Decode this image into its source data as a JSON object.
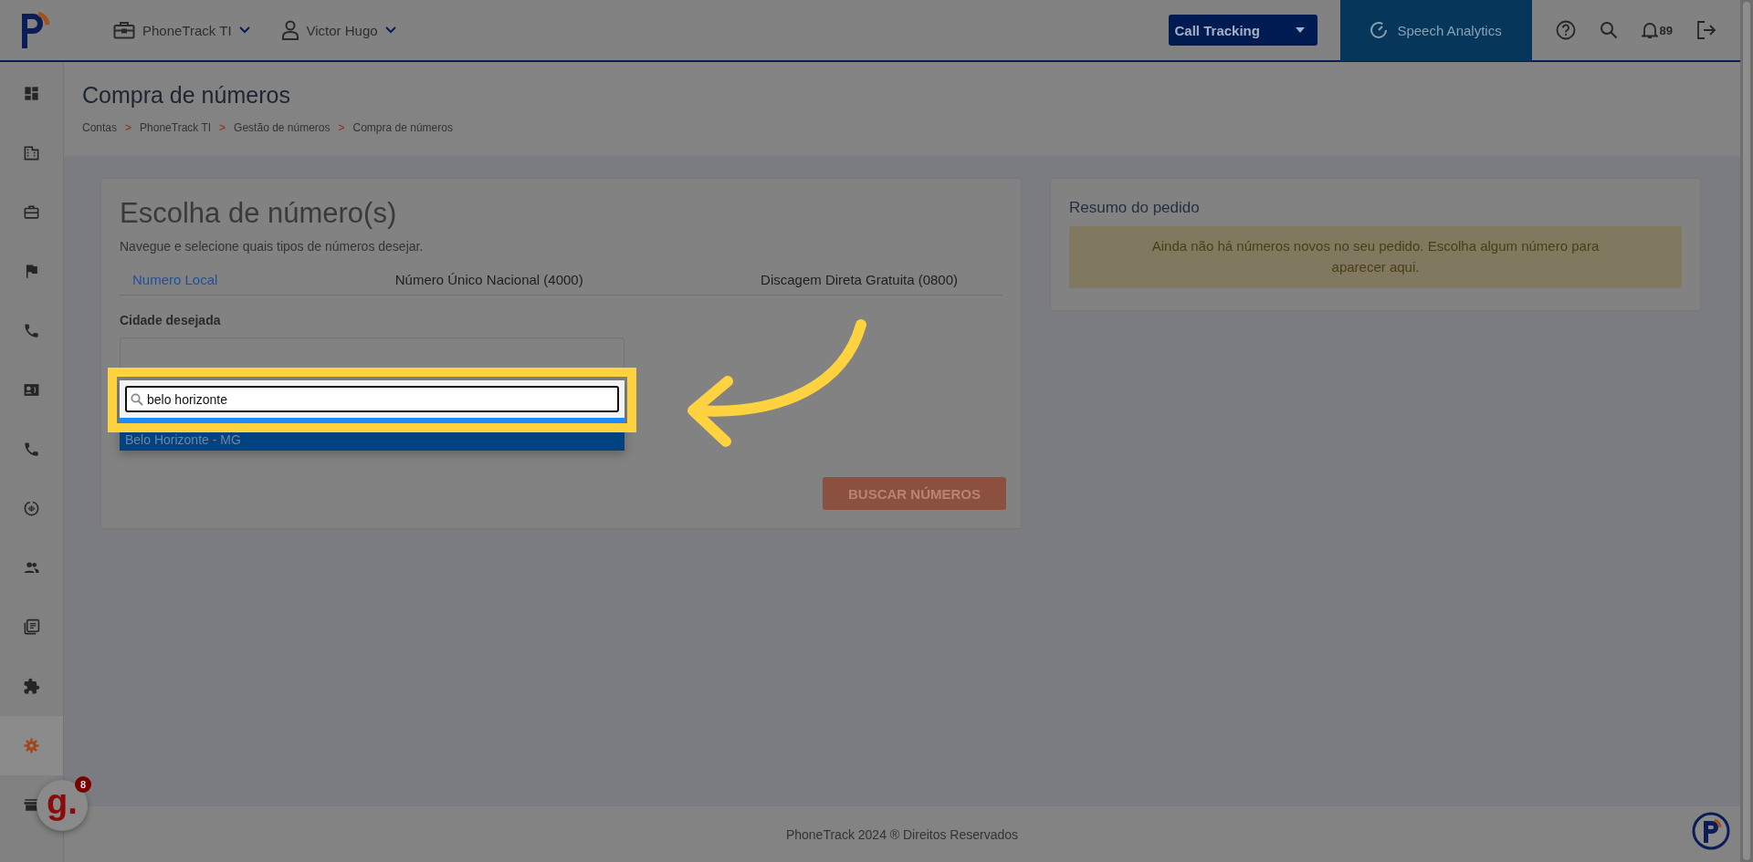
{
  "topbar": {
    "account": "PhoneTrack TI",
    "user": "Victor Hugo",
    "product_select": "Call Tracking",
    "speech_analytics": "Speech Analytics",
    "notifications": "89"
  },
  "sidebar": {
    "items": [
      {
        "kind": "dashboard",
        "selected": false
      },
      {
        "kind": "building",
        "selected": false
      },
      {
        "kind": "briefcase",
        "selected": false
      },
      {
        "kind": "flag",
        "selected": false
      },
      {
        "kind": "phone",
        "selected": false
      },
      {
        "kind": "contact",
        "selected": false
      },
      {
        "kind": "phone",
        "selected": false
      },
      {
        "kind": "audio",
        "selected": false
      },
      {
        "kind": "people",
        "selected": false
      },
      {
        "kind": "library",
        "selected": false
      },
      {
        "kind": "puzzle",
        "selected": false
      },
      {
        "kind": "gear",
        "selected": true
      },
      {
        "kind": "store",
        "selected": false
      }
    ]
  },
  "page": {
    "title": "Compra de números",
    "breadcrumb": {
      "separator": ">",
      "items": [
        "Contas",
        "PhoneTrack TI",
        "Gestão de números",
        "Compra de números"
      ]
    }
  },
  "choice_card": {
    "title": "Escolha de número(s)",
    "subtitle": "Navegue e selecione quais tipos de números desejar.",
    "tabs": [
      {
        "label": "Numero Local",
        "selected": true
      },
      {
        "label": "Número Único Nacional (4000)",
        "selected": false
      },
      {
        "label": "Discagem Direta Gratuita (0800)",
        "selected": false
      }
    ],
    "city_label": "Cidade desejada",
    "city_search": {
      "value": "belo horizonte"
    },
    "options": [
      {
        "label": "Belo Horizonte - MG",
        "selected": true
      }
    ],
    "search_button": "BUSCAR NÚMEROS"
  },
  "summary_card": {
    "title": "Resumo do pedido",
    "notice": "Ainda não há números novos no seu pedido. Escolha algum número para aparecer aqui."
  },
  "footer": "PhoneTrack 2024 ® Direitos Reservados",
  "helper_widget": {
    "label": "g.",
    "badge": "8"
  }
}
